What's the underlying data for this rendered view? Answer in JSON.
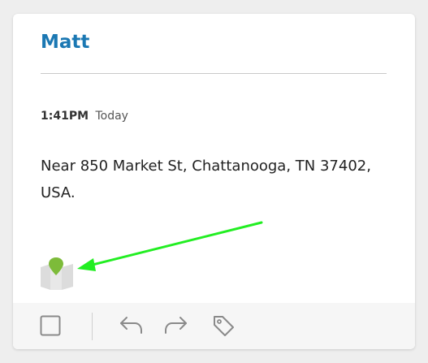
{
  "message": {
    "sender": "Matt",
    "time": "1:41PM",
    "day": "Today",
    "address": "Near 850 Market St, Chattanooga, TN 37402, USA."
  },
  "icons": {
    "map": "map-pin-icon",
    "select": "checkbox-icon",
    "reply": "reply-icon",
    "forward": "forward-icon",
    "tag": "tag-icon"
  },
  "colors": {
    "title": "#1b78b3",
    "pin": "#7dbb3a",
    "annotation_arrow": "#22ee22"
  }
}
